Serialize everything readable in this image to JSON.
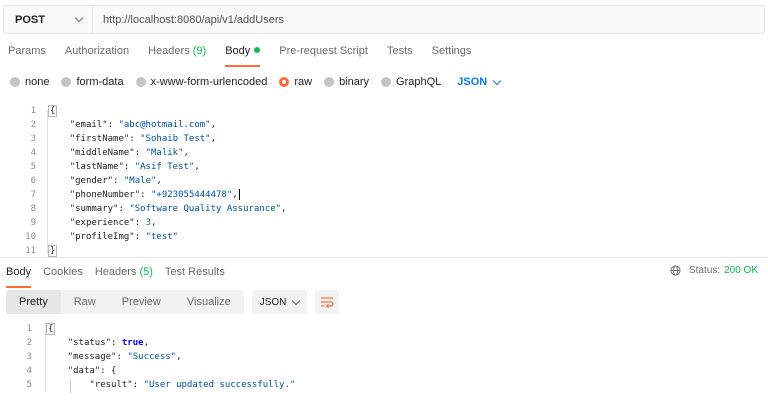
{
  "request": {
    "method": "POST",
    "url": "http://localhost:8080/api/v1/addUsers"
  },
  "request_tabs": [
    {
      "label": "Params"
    },
    {
      "label": "Authorization"
    },
    {
      "label": "Headers",
      "count": "(9)"
    },
    {
      "label": "Body",
      "active": true
    },
    {
      "label": "Pre-request Script"
    },
    {
      "label": "Tests"
    },
    {
      "label": "Settings"
    }
  ],
  "body_types": {
    "none": "none",
    "form_data": "form-data",
    "urlencoded": "x-www-form-urlencoded",
    "raw": "raw",
    "binary": "binary",
    "graphql": "GraphQL",
    "selected": "raw",
    "format": "JSON"
  },
  "request_body": [
    {
      "n": "1",
      "text": "{"
    },
    {
      "n": "2",
      "key": "\"email\"",
      "val": "\"abc@hotmail.com\"",
      "tail": ","
    },
    {
      "n": "3",
      "key": "\"firstName\"",
      "val": "\"Sohaib Test\"",
      "tail": ","
    },
    {
      "n": "4",
      "key": "\"middleName\"",
      "val": "\"Malik\"",
      "tail": ","
    },
    {
      "n": "5",
      "key": "\"lastName\"",
      "val": "\"Asif Test\"",
      "tail": ","
    },
    {
      "n": "6",
      "key": "\"gender\"",
      "val": "\"Male\"",
      "tail": ","
    },
    {
      "n": "7",
      "key": "\"phoneNumber\"",
      "val": "\"+923055444478\"",
      "tail": ","
    },
    {
      "n": "8",
      "key": "\"summary\"",
      "val": "\"Software Quality Assurance\"",
      "tail": ","
    },
    {
      "n": "9",
      "key": "\"experience\"",
      "val": "3",
      "tail": ","
    },
    {
      "n": "10",
      "key": "\"profileImg\"",
      "val": "\"test\"",
      "tail": ""
    },
    {
      "n": "11",
      "text": "}"
    }
  ],
  "response_tabs": {
    "body": "Body",
    "cookies": "Cookies",
    "headers": "Headers",
    "headers_count": "(5)",
    "test_results": "Test Results"
  },
  "status": {
    "label": "Status:",
    "value": "200 OK"
  },
  "response_toolbar": {
    "pretty": "Pretty",
    "raw": "Raw",
    "preview": "Preview",
    "visualize": "Visualize",
    "format": "JSON"
  },
  "response_body": [
    {
      "n": "1",
      "text": "{"
    },
    {
      "n": "2",
      "key": "\"status\"",
      "val": "true",
      "tail": ","
    },
    {
      "n": "3",
      "key": "\"message\"",
      "val": "\"Success\"",
      "tail": ","
    },
    {
      "n": "4",
      "key": "\"data\"",
      "text_after": "{"
    },
    {
      "n": "5",
      "key": "\"result\"",
      "val": "\"User updated successfully.\""
    }
  ],
  "colors": {
    "accent": "#ff6c37",
    "success": "#0cbb52",
    "link": "#097bed"
  }
}
